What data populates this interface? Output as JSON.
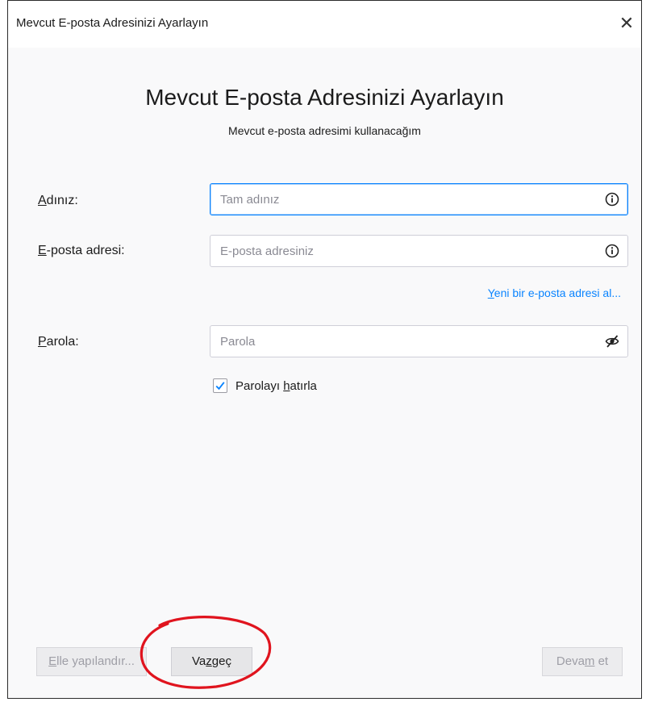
{
  "window": {
    "title": "Mevcut E-posta Adresinizi Ayarlayın",
    "close_symbol": "✕"
  },
  "header": {
    "heading": "Mevcut E-posta Adresinizi Ayarlayın",
    "subheading": "Mevcut e-posta adresimi kullanacağım"
  },
  "form": {
    "name": {
      "label_first": "A",
      "label_rest": "dınız:",
      "placeholder": "Tam adınız",
      "value": "",
      "icon": "info-icon"
    },
    "email": {
      "label_first": "E",
      "label_rest": "-posta adresi:",
      "placeholder": "E-posta adresiniz",
      "value": "",
      "icon": "info-icon"
    },
    "new_email_link": {
      "first": "Y",
      "rest": "eni bir e-posta adresi al..."
    },
    "password": {
      "label_first": "P",
      "label_rest": "arola:",
      "placeholder": "Parola",
      "value": "",
      "icon": "eye-slash-icon"
    },
    "remember": {
      "label_pre": "Parolayı ",
      "label_u": "h",
      "label_post": "atırla",
      "checked": true
    }
  },
  "footer": {
    "manual_first": "E",
    "manual_rest": "lle yapılandır...",
    "cancel_pre": "Va",
    "cancel_u": "z",
    "cancel_post": "geç",
    "continue_pre": "Deva",
    "continue_u": "m",
    "continue_post": " et"
  },
  "annotation": {
    "shape": "ellipse",
    "color": "#e0141e"
  },
  "colors": {
    "accent": "#0a84ff",
    "annotation": "#e0141e"
  }
}
